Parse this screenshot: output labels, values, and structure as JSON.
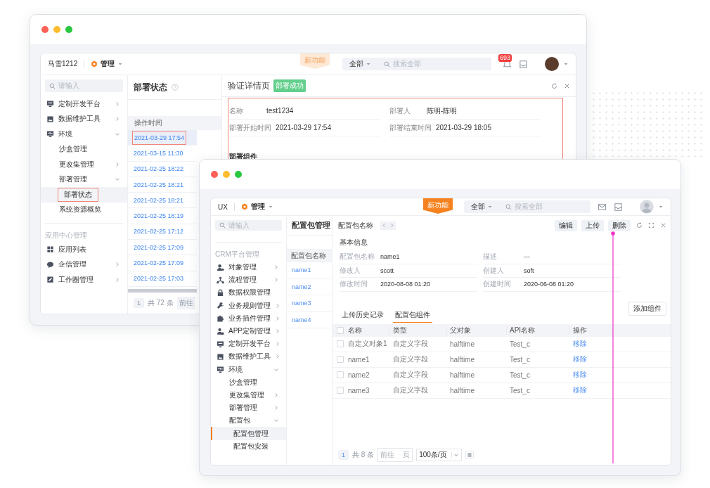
{
  "back_window": {
    "header": {
      "workspace": "马雪1212",
      "menu_label": "管理",
      "new_feature_tag": "新功能",
      "search_scope": "全部",
      "search_placeholder": "搜索全部",
      "notification_count": "693"
    },
    "sidebar": {
      "search_placeholder": "请输入",
      "sections": [
        {
          "items": [
            {
              "label": "定制开发平台",
              "expanded": false,
              "selected": false,
              "highlighted": false
            },
            {
              "label": "数据维护工具",
              "expanded": false,
              "selected": false,
              "highlighted": false
            },
            {
              "label": "环境",
              "expanded": true,
              "selected": false,
              "highlighted": false,
              "children": [
                {
                  "label": "沙盒管理",
                  "selected": false,
                  "highlighted": false
                },
                {
                  "label": "更改集管理",
                  "expanded": false,
                  "selected": false,
                  "highlighted": false
                },
                {
                  "label": "部署管理",
                  "expanded": true,
                  "selected": false,
                  "highlighted": false,
                  "children": [
                    {
                      "label": "部署状态",
                      "selected": true,
                      "highlighted": true
                    }
                  ]
                },
                {
                  "label": "系统资源概览",
                  "selected": false,
                  "highlighted": false
                }
              ]
            }
          ]
        },
        {
          "title": "应用中心管理",
          "items": [
            {
              "label": "应用列表",
              "selected": false,
              "highlighted": false
            },
            {
              "label": "企信管理",
              "expanded": false,
              "selected": false,
              "highlighted": false
            },
            {
              "label": "工作圈管理",
              "expanded": false,
              "selected": false,
              "highlighted": false
            }
          ]
        }
      ]
    },
    "list_panel": {
      "title": "部署状态",
      "column": "操作时间",
      "rows": [
        {
          "time": "2021-03-29 17:54",
          "selected": true,
          "highlighted": true
        },
        {
          "time": "2021-03-15 11:30",
          "selected": false,
          "highlighted": false
        },
        {
          "time": "2021-02-25 18:22",
          "selected": false,
          "highlighted": false
        },
        {
          "time": "2021-02-25 18:21",
          "selected": false,
          "highlighted": false
        },
        {
          "time": "2021-02-25 18:21",
          "selected": false,
          "highlighted": false
        },
        {
          "time": "2021-02-25 18:19",
          "selected": false,
          "highlighted": false
        },
        {
          "time": "2021-02-25 17:12",
          "selected": false,
          "highlighted": false
        },
        {
          "time": "2021-02-25 17:09",
          "selected": false,
          "highlighted": false
        },
        {
          "time": "2021-02-25 17:09",
          "selected": false,
          "highlighted": false
        },
        {
          "time": "2021-02-25 17:03",
          "selected": false,
          "highlighted": false
        }
      ],
      "pagination": {
        "page": "1",
        "total": "共 72 条",
        "goto": "前往"
      }
    },
    "detail": {
      "title": "验证详情页",
      "status": "部署成功",
      "highlighted": true,
      "fields": [
        {
          "label": "名称",
          "value": "test1234"
        },
        {
          "label": "部署人",
          "value": "陈明-陈明"
        },
        {
          "label": "部署开始时间",
          "value": "2021-03-29 17:54"
        },
        {
          "label": "部署结束时间",
          "value": "2021-03-29 18:05"
        }
      ],
      "section": "部署组件"
    }
  },
  "front_window": {
    "header": {
      "workspace": "UX",
      "menu_label": "管理",
      "new_feature_tag": "新功能",
      "search_scope": "全部",
      "search_placeholder": "搜索全部"
    },
    "sidebar": {
      "search_placeholder": "请输入",
      "sections": [
        {
          "title": "CRM平台管理",
          "items": [
            {
              "label": "对象管理",
              "expanded": false,
              "selected": false
            },
            {
              "label": "流程管理",
              "expanded": false,
              "selected": false
            },
            {
              "label": "数据权限管理",
              "selected": false
            },
            {
              "label": "业务规则管理",
              "expanded": false,
              "selected": false
            },
            {
              "label": "业务插件管理",
              "expanded": false,
              "selected": false
            },
            {
              "label": "APP定制管理",
              "expanded": false,
              "selected": false
            },
            {
              "label": "定制开发平台",
              "expanded": false,
              "selected": false
            },
            {
              "label": "数据维护工具",
              "expanded": false,
              "selected": false
            },
            {
              "label": "环境",
              "expanded": true,
              "selected": false,
              "children": [
                {
                  "label": "沙盒管理",
                  "selected": false
                },
                {
                  "label": "更改集管理",
                  "expanded": false,
                  "selected": false
                },
                {
                  "label": "部署管理",
                  "expanded": false,
                  "selected": false
                },
                {
                  "label": "配置包",
                  "expanded": true,
                  "selected": false,
                  "children": [
                    {
                      "label": "配置包管理",
                      "selected": true
                    },
                    {
                      "label": "配置包安装",
                      "selected": false
                    }
                  ]
                }
              ]
            }
          ]
        }
      ]
    },
    "list_panel": {
      "title": "配置包管理",
      "column": "配置包名称",
      "rows": [
        {
          "name": "name1"
        },
        {
          "name": "name2"
        },
        {
          "name": "name3"
        },
        {
          "name": "name4"
        }
      ]
    },
    "detail": {
      "title": "配置包名称",
      "actions": [
        "编辑",
        "上传",
        "删除"
      ],
      "section": "基本信息",
      "fields": [
        {
          "label": "配置包名称",
          "value": "name1"
        },
        {
          "label": "描述",
          "value": "---"
        },
        {
          "label": "修改人",
          "value": "scott"
        },
        {
          "label": "创建人",
          "value": "soft"
        },
        {
          "label": "修改时间",
          "value": "2020-08-08 01:20"
        },
        {
          "label": "创建时间",
          "value": "2020-06-08 01:20"
        }
      ],
      "tabs": [
        {
          "label": "上传历史记录",
          "selected": false
        },
        {
          "label": "配置包组件",
          "selected": true
        }
      ],
      "add_button": "添加组件",
      "table": {
        "columns": [
          "名称",
          "类型",
          "父对象",
          "API名称",
          "操作"
        ],
        "select_all_checked": false,
        "rows": [
          {
            "checked": false,
            "cells": [
              "自定义对象1",
              "自定义字段",
              "halftime",
              "Test_c"
            ],
            "action": "移除"
          },
          {
            "checked": false,
            "cells": [
              "name1",
              "自定义字段",
              "halftime",
              "Test_c"
            ],
            "action": "移除"
          },
          {
            "checked": false,
            "cells": [
              "name2",
              "自定义字段",
              "halftime",
              "Test_c"
            ],
            "action": "移除"
          },
          {
            "checked": false,
            "cells": [
              "name3",
              "自定义字段",
              "halftime",
              "Test_c"
            ],
            "action": "移除"
          }
        ]
      },
      "pagination": {
        "page": "1",
        "total": "共 8 条",
        "goto": "前往",
        "goto_suffix": "页",
        "page_size": "100条/页"
      }
    }
  }
}
